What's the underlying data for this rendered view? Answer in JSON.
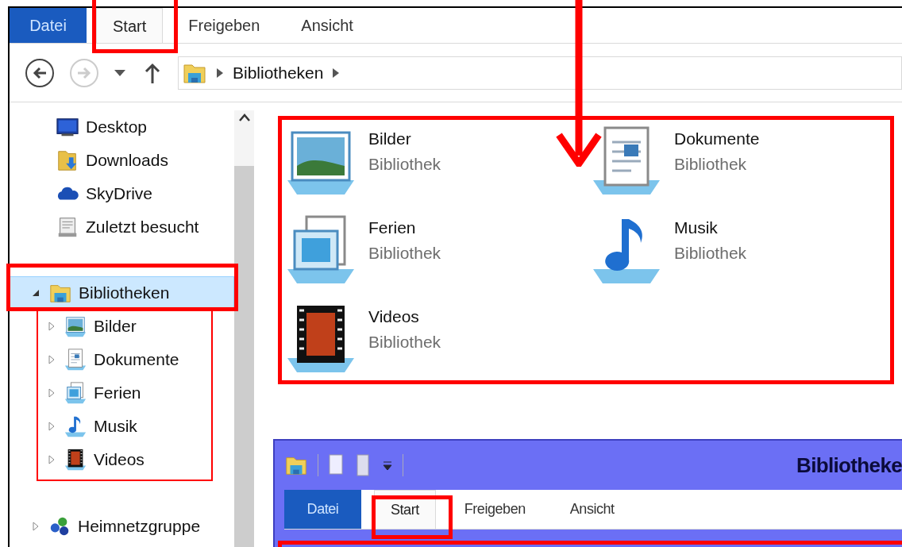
{
  "ribbon_tabs": [
    {
      "label": "Datei",
      "kind": "file",
      "selected": false
    },
    {
      "label": "Start",
      "kind": "tab",
      "selected": true
    },
    {
      "label": "Freigeben",
      "kind": "tab",
      "selected": false
    },
    {
      "label": "Ansicht",
      "kind": "tab",
      "selected": false
    }
  ],
  "address_bar": {
    "forward_disabled": true,
    "breadcrumb": [
      "Bibliotheken"
    ]
  },
  "nav_pane": {
    "quick_access": [
      {
        "label": "Desktop",
        "kind": "desktop"
      },
      {
        "label": "Downloads",
        "kind": "downloads"
      },
      {
        "label": "SkyDrive",
        "kind": "cloud"
      },
      {
        "label": "Zuletzt besucht",
        "kind": "recent"
      }
    ],
    "tree": [
      {
        "label": "Bibliotheken",
        "kind": "library",
        "selected": true,
        "expanded": true,
        "children": [
          {
            "label": "Bilder",
            "kind": "pictures",
            "selected": false,
            "expanded": false
          },
          {
            "label": "Dokumente",
            "kind": "documents",
            "selected": false,
            "expanded": false
          },
          {
            "label": "Ferien",
            "kind": "generic",
            "selected": false,
            "expanded": false
          },
          {
            "label": "Musik",
            "kind": "music",
            "selected": false,
            "expanded": false
          },
          {
            "label": "Videos",
            "kind": "videos",
            "selected": false,
            "expanded": false
          }
        ]
      },
      {
        "label": "Heimnetzgruppe",
        "kind": "homegroup",
        "selected": false,
        "expanded": false
      }
    ]
  },
  "libraries": [
    {
      "name": "Bilder",
      "type": "Bibliothek",
      "kind": "pictures"
    },
    {
      "name": "Dokumente",
      "type": "Bibliothek",
      "kind": "documents"
    },
    {
      "name": "Ferien",
      "type": "Bibliothek",
      "kind": "generic"
    },
    {
      "name": "Musik",
      "type": "Bibliothek",
      "kind": "music"
    },
    {
      "name": "Videos",
      "type": "Bibliothek",
      "kind": "videos"
    }
  ],
  "inset_window": {
    "title": "Bibliotheke",
    "ribbon_tabs": [
      {
        "label": "Datei",
        "kind": "file",
        "selected": false
      },
      {
        "label": "Start",
        "kind": "tab",
        "selected": true
      },
      {
        "label": "Freigeben",
        "kind": "tab",
        "selected": false
      },
      {
        "label": "Ansicht",
        "kind": "tab",
        "selected": false
      }
    ]
  }
}
